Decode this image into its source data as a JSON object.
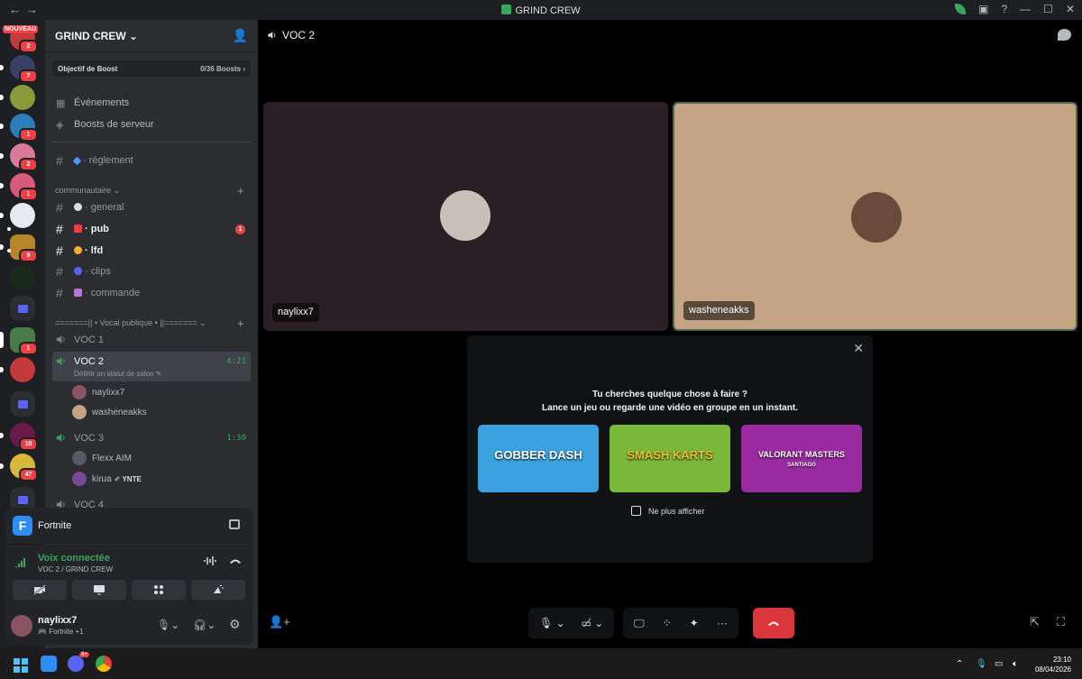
{
  "window": {
    "title": "GRIND CREW"
  },
  "server": {
    "name": "GRIND CREW",
    "boost_label": "Objectif de Boost",
    "boost_count": "0/36 Boosts",
    "nouveau_label": "NOUVEAU",
    "guild_badges": [
      "2",
      "7",
      "1",
      "2",
      "1",
      "9",
      "1",
      "10",
      "47"
    ]
  },
  "sidebar": {
    "events": "Événements",
    "boosts": "Boosts de serveur",
    "rules_channel": "règlement",
    "category_community": "communautaire",
    "channels": [
      {
        "name": "general",
        "bold": false
      },
      {
        "name": "pub",
        "bold": true,
        "unread": "1"
      },
      {
        "name": "lfd",
        "bold": true
      },
      {
        "name": "clips",
        "bold": false
      },
      {
        "name": "commande",
        "bold": false
      }
    ],
    "category_voice": "=======|| • Vocal publique • ||=======",
    "voice": [
      {
        "name": "VOC 1"
      },
      {
        "name": "VOC 2",
        "timer": "4:21",
        "status": "Définir un statut de salon",
        "members": [
          "naylixx7",
          "washeneakks"
        ]
      },
      {
        "name": "VOC 3",
        "timer": "1:30",
        "members": [
          "Flexx AIM",
          "kirua"
        ],
        "tag": "YNTE"
      },
      {
        "name": "VOC 4"
      }
    ]
  },
  "activity": {
    "game": "Fortnite",
    "game_letter": "F"
  },
  "voice_panel": {
    "status": "Voix connectée",
    "channel": "VOC 2 / GRIND CREW"
  },
  "user": {
    "name": "naylixx7",
    "status": "Fortnite +1"
  },
  "main": {
    "channel": "VOC 2",
    "tiles": [
      {
        "name": "naylixx7",
        "bg": "#2a1f24"
      },
      {
        "name": "washeneakks",
        "bg": "#c4a484"
      }
    ],
    "popup": {
      "title": "Tu cherches quelque chose à faire ?",
      "subtitle": "Lance un jeu ou regarde une vidéo en groupe en un instant.",
      "games": [
        "GOBBER DASH",
        "SMASH KARTS",
        "VALORANT MASTERS"
      ],
      "games_sub": [
        "",
        "",
        "SANTIAGO"
      ],
      "checkbox": "Ne plus afficher"
    }
  },
  "taskbar": {
    "time": "23:10",
    "date": "08/04/2026",
    "discord_badge": "9+"
  }
}
